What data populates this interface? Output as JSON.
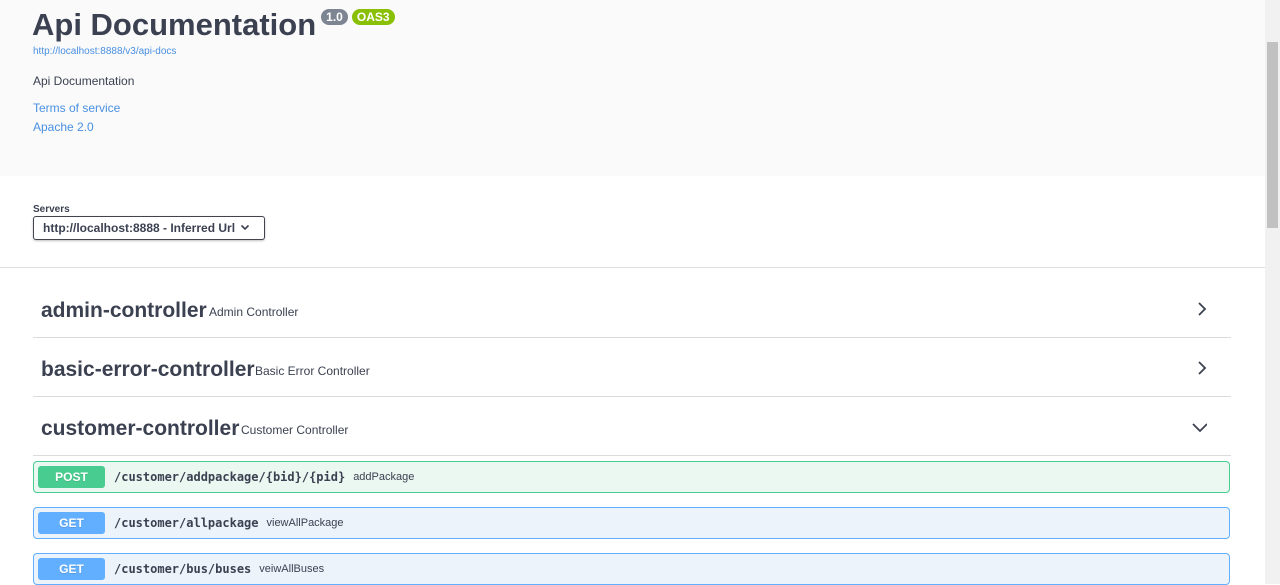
{
  "info": {
    "title": "Api Documentation",
    "version_badge": "1.0",
    "oas_badge": "OAS3",
    "spec_url": "http://localhost:8888/v3/api-docs",
    "description": "Api Documentation",
    "terms_link": "Terms of service",
    "license_link": "Apache 2.0"
  },
  "servers": {
    "label": "Servers",
    "selected": "http://localhost:8888 - Inferred Url"
  },
  "tags": [
    {
      "name": "admin-controller",
      "description": "Admin Controller",
      "expanded": false
    },
    {
      "name": "basic-error-controller",
      "description": "Basic Error Controller",
      "expanded": false
    },
    {
      "name": "customer-controller",
      "description": "Customer Controller",
      "expanded": true
    }
  ],
  "operations": [
    {
      "method": "POST",
      "path": "/customer/addpackage/{bid}/{pid}",
      "summary": "addPackage"
    },
    {
      "method": "GET",
      "path": "/customer/allpackage",
      "summary": "viewAllPackage"
    },
    {
      "method": "GET",
      "path": "/customer/bus/buses",
      "summary": "veiwAllBuses"
    }
  ],
  "colors": {
    "post": "#49cc90",
    "get": "#61affe",
    "link": "#4990e2",
    "oas_badge": "#89bf04",
    "version_badge": "#7d8492"
  }
}
